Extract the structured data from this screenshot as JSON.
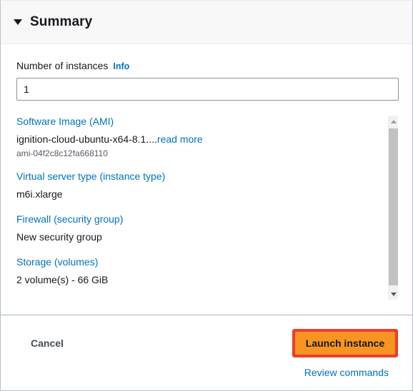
{
  "panel": {
    "title": "Summary",
    "collapse_icon": "caret-down-icon"
  },
  "instances_field": {
    "label": "Number of instances",
    "info_label": "Info",
    "value": "1",
    "placeholder": ""
  },
  "details": [
    {
      "link": "Software Image (AMI)",
      "value": "ignition-cloud-ubuntu-x64-8.1....",
      "value_link": "read more",
      "sub": "ami-04f2c8c12fa668110"
    },
    {
      "link": "Virtual server type (instance type)",
      "value": "m6i.xlarge",
      "value_link": "",
      "sub": ""
    },
    {
      "link": "Firewall (security group)",
      "value": "New security group",
      "value_link": "",
      "sub": ""
    },
    {
      "link": "Storage (volumes)",
      "value": "2 volume(s) - 66 GiB",
      "value_link": "",
      "sub": ""
    }
  ],
  "scrollbar": {
    "up_icon": "scroll-up-arrow-icon",
    "down_icon": "scroll-down-arrow-icon"
  },
  "footer": {
    "cancel_label": "Cancel",
    "launch_label": "Launch instance",
    "review_label": "Review commands"
  },
  "colors": {
    "link": "#0073bb",
    "button_orange": "#f89520",
    "highlight_red": "#ee3d2d",
    "text": "#16191f",
    "header_bg": "#f8f8f8"
  }
}
